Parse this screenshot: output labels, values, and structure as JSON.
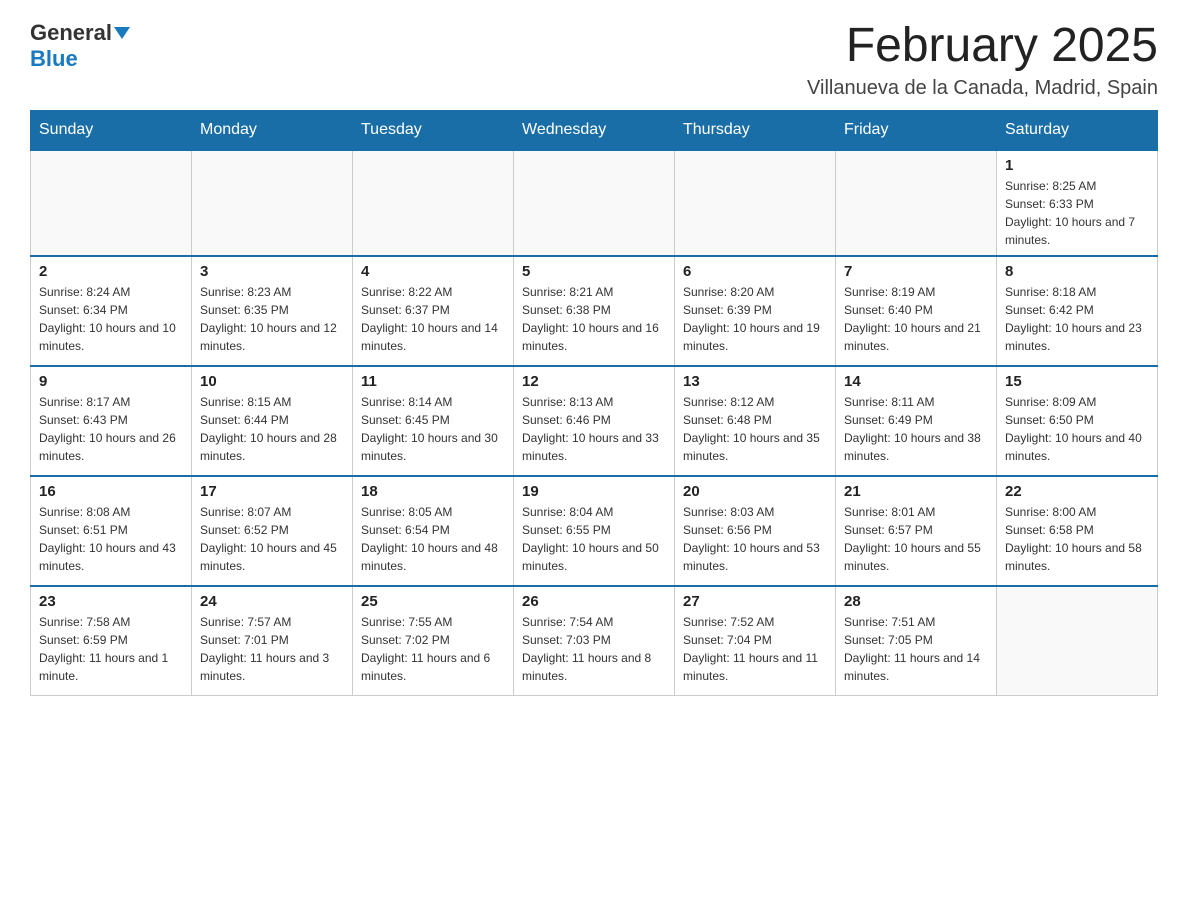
{
  "header": {
    "logo_general": "General",
    "logo_blue": "Blue",
    "month_title": "February 2025",
    "location": "Villanueva de la Canada, Madrid, Spain"
  },
  "weekdays": [
    "Sunday",
    "Monday",
    "Tuesday",
    "Wednesday",
    "Thursday",
    "Friday",
    "Saturday"
  ],
  "rows": [
    [
      {
        "day": "",
        "info": ""
      },
      {
        "day": "",
        "info": ""
      },
      {
        "day": "",
        "info": ""
      },
      {
        "day": "",
        "info": ""
      },
      {
        "day": "",
        "info": ""
      },
      {
        "day": "",
        "info": ""
      },
      {
        "day": "1",
        "info": "Sunrise: 8:25 AM\nSunset: 6:33 PM\nDaylight: 10 hours and 7 minutes."
      }
    ],
    [
      {
        "day": "2",
        "info": "Sunrise: 8:24 AM\nSunset: 6:34 PM\nDaylight: 10 hours and 10 minutes."
      },
      {
        "day": "3",
        "info": "Sunrise: 8:23 AM\nSunset: 6:35 PM\nDaylight: 10 hours and 12 minutes."
      },
      {
        "day": "4",
        "info": "Sunrise: 8:22 AM\nSunset: 6:37 PM\nDaylight: 10 hours and 14 minutes."
      },
      {
        "day": "5",
        "info": "Sunrise: 8:21 AM\nSunset: 6:38 PM\nDaylight: 10 hours and 16 minutes."
      },
      {
        "day": "6",
        "info": "Sunrise: 8:20 AM\nSunset: 6:39 PM\nDaylight: 10 hours and 19 minutes."
      },
      {
        "day": "7",
        "info": "Sunrise: 8:19 AM\nSunset: 6:40 PM\nDaylight: 10 hours and 21 minutes."
      },
      {
        "day": "8",
        "info": "Sunrise: 8:18 AM\nSunset: 6:42 PM\nDaylight: 10 hours and 23 minutes."
      }
    ],
    [
      {
        "day": "9",
        "info": "Sunrise: 8:17 AM\nSunset: 6:43 PM\nDaylight: 10 hours and 26 minutes."
      },
      {
        "day": "10",
        "info": "Sunrise: 8:15 AM\nSunset: 6:44 PM\nDaylight: 10 hours and 28 minutes."
      },
      {
        "day": "11",
        "info": "Sunrise: 8:14 AM\nSunset: 6:45 PM\nDaylight: 10 hours and 30 minutes."
      },
      {
        "day": "12",
        "info": "Sunrise: 8:13 AM\nSunset: 6:46 PM\nDaylight: 10 hours and 33 minutes."
      },
      {
        "day": "13",
        "info": "Sunrise: 8:12 AM\nSunset: 6:48 PM\nDaylight: 10 hours and 35 minutes."
      },
      {
        "day": "14",
        "info": "Sunrise: 8:11 AM\nSunset: 6:49 PM\nDaylight: 10 hours and 38 minutes."
      },
      {
        "day": "15",
        "info": "Sunrise: 8:09 AM\nSunset: 6:50 PM\nDaylight: 10 hours and 40 minutes."
      }
    ],
    [
      {
        "day": "16",
        "info": "Sunrise: 8:08 AM\nSunset: 6:51 PM\nDaylight: 10 hours and 43 minutes."
      },
      {
        "day": "17",
        "info": "Sunrise: 8:07 AM\nSunset: 6:52 PM\nDaylight: 10 hours and 45 minutes."
      },
      {
        "day": "18",
        "info": "Sunrise: 8:05 AM\nSunset: 6:54 PM\nDaylight: 10 hours and 48 minutes."
      },
      {
        "day": "19",
        "info": "Sunrise: 8:04 AM\nSunset: 6:55 PM\nDaylight: 10 hours and 50 minutes."
      },
      {
        "day": "20",
        "info": "Sunrise: 8:03 AM\nSunset: 6:56 PM\nDaylight: 10 hours and 53 minutes."
      },
      {
        "day": "21",
        "info": "Sunrise: 8:01 AM\nSunset: 6:57 PM\nDaylight: 10 hours and 55 minutes."
      },
      {
        "day": "22",
        "info": "Sunrise: 8:00 AM\nSunset: 6:58 PM\nDaylight: 10 hours and 58 minutes."
      }
    ],
    [
      {
        "day": "23",
        "info": "Sunrise: 7:58 AM\nSunset: 6:59 PM\nDaylight: 11 hours and 1 minute."
      },
      {
        "day": "24",
        "info": "Sunrise: 7:57 AM\nSunset: 7:01 PM\nDaylight: 11 hours and 3 minutes."
      },
      {
        "day": "25",
        "info": "Sunrise: 7:55 AM\nSunset: 7:02 PM\nDaylight: 11 hours and 6 minutes."
      },
      {
        "day": "26",
        "info": "Sunrise: 7:54 AM\nSunset: 7:03 PM\nDaylight: 11 hours and 8 minutes."
      },
      {
        "day": "27",
        "info": "Sunrise: 7:52 AM\nSunset: 7:04 PM\nDaylight: 11 hours and 11 minutes."
      },
      {
        "day": "28",
        "info": "Sunrise: 7:51 AM\nSunset: 7:05 PM\nDaylight: 11 hours and 14 minutes."
      },
      {
        "day": "",
        "info": ""
      }
    ]
  ]
}
